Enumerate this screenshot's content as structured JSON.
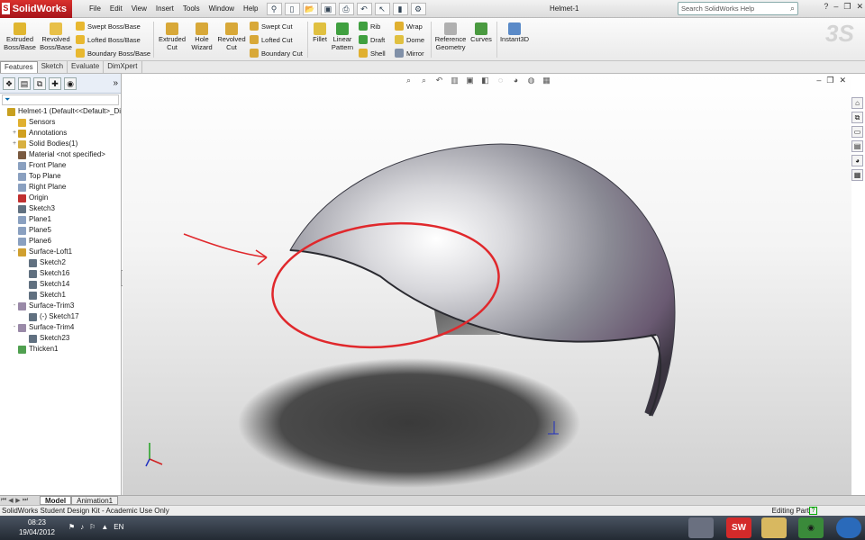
{
  "app": {
    "name": "SolidWorks",
    "doc_title": "Helmet-1"
  },
  "menu": [
    "File",
    "Edit",
    "View",
    "Insert",
    "Tools",
    "Window",
    "Help"
  ],
  "search": {
    "placeholder": "Search SolidWorks Help"
  },
  "commands": {
    "extruded_boss": [
      "Extruded",
      "Boss/Base"
    ],
    "revolved_boss": [
      "Revolved",
      "Boss/Base"
    ],
    "swept_boss": "Swept Boss/Base",
    "lofted_boss": "Lofted Boss/Base",
    "boundary_boss": "Boundary Boss/Base",
    "extruded_cut": [
      "Extruded",
      "Cut"
    ],
    "hole_wizard": [
      "Hole",
      "Wizard"
    ],
    "revolved_cut": [
      "Revolved",
      "Cut"
    ],
    "swept_cut": "Swept Cut",
    "lofted_cut": "Lofted Cut",
    "boundary_cut": "Boundary Cut",
    "fillet": "Fillet",
    "linear_pattern": [
      "Linear",
      "Pattern"
    ],
    "rib": "Rib",
    "draft": "Draft",
    "shell": "Shell",
    "wrap": "Wrap",
    "dome": "Dome",
    "mirror": "Mirror",
    "reference_geometry": [
      "Reference",
      "Geometry"
    ],
    "curves": "Curves",
    "instant3d": "Instant3D"
  },
  "tabs": [
    "Features",
    "Sketch",
    "Evaluate",
    "DimXpert"
  ],
  "active_tab": "Features",
  "tree": [
    {
      "label": "Helmet-1  (Default<<Default>_Di",
      "indent": 0,
      "expander": "",
      "color": "#c8a020"
    },
    {
      "label": "Sensors",
      "indent": 1,
      "expander": "",
      "color": "#e0b030"
    },
    {
      "label": "Annotations",
      "indent": 1,
      "expander": "+",
      "color": "#d0a020"
    },
    {
      "label": "Solid Bodies(1)",
      "indent": 1,
      "expander": "+",
      "color": "#d8b040"
    },
    {
      "label": "Material <not specified>",
      "indent": 1,
      "expander": "",
      "color": "#7a5a40"
    },
    {
      "label": "Front Plane",
      "indent": 1,
      "expander": "",
      "color": "#8aa0c0"
    },
    {
      "label": "Top Plane",
      "indent": 1,
      "expander": "",
      "color": "#8aa0c0"
    },
    {
      "label": "Right Plane",
      "indent": 1,
      "expander": "",
      "color": "#8aa0c0"
    },
    {
      "label": "Origin",
      "indent": 1,
      "expander": "",
      "color": "#c03030"
    },
    {
      "label": "Sketch3",
      "indent": 1,
      "expander": "",
      "color": "#607080"
    },
    {
      "label": "Plane1",
      "indent": 1,
      "expander": "",
      "color": "#8aa0c0"
    },
    {
      "label": "Plane5",
      "indent": 1,
      "expander": "",
      "color": "#8aa0c0"
    },
    {
      "label": "Plane6",
      "indent": 1,
      "expander": "",
      "color": "#8aa0c0"
    },
    {
      "label": "Surface-Loft1",
      "indent": 1,
      "expander": "-",
      "color": "#d0a030"
    },
    {
      "label": "Sketch2",
      "indent": 2,
      "expander": "",
      "color": "#607080"
    },
    {
      "label": "Sketch16",
      "indent": 2,
      "expander": "",
      "color": "#607080"
    },
    {
      "label": "Sketch14",
      "indent": 2,
      "expander": "",
      "color": "#607080"
    },
    {
      "label": "Sketch1",
      "indent": 2,
      "expander": "",
      "color": "#607080"
    },
    {
      "label": "Surface-Trim3",
      "indent": 1,
      "expander": "-",
      "color": "#9a8aa8"
    },
    {
      "label": "(-) Sketch17",
      "indent": 2,
      "expander": "",
      "color": "#607080"
    },
    {
      "label": "Surface-Trim4",
      "indent": 1,
      "expander": "-",
      "color": "#9a8aa8"
    },
    {
      "label": "Sketch23",
      "indent": 2,
      "expander": "",
      "color": "#607080"
    },
    {
      "label": "Thicken1",
      "indent": 1,
      "expander": "",
      "color": "#50a050"
    }
  ],
  "bottom_tabs": [
    "Model",
    "Animation1"
  ],
  "status": {
    "left": "SolidWorks Student Design Kit - Academic Use Only",
    "right": "Editing Part"
  },
  "taskbar": {
    "time": "08:23",
    "date": "19/04/2012",
    "lang": "EN"
  },
  "colors": {
    "accent_red": "#d42a2a",
    "annotation_red": "#e0282c",
    "helmet_shell": "#b8b8be",
    "shadow": "#3a3a3a"
  }
}
